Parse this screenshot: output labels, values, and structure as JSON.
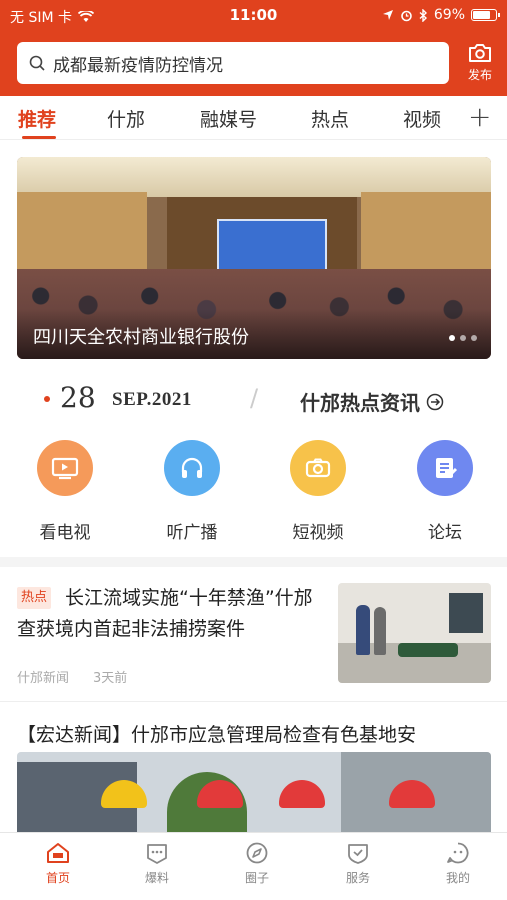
{
  "status": {
    "carrier": "无 SIM 卡",
    "time": "11:00",
    "battery": "69%",
    "battery_level": 0.69
  },
  "header": {
    "search_placeholder": "成都最新疫情防控情况",
    "publish_label": "发布"
  },
  "tabs": [
    {
      "label": "推荐",
      "active": true
    },
    {
      "label": "什邡"
    },
    {
      "label": "融媒号"
    },
    {
      "label": "热点"
    },
    {
      "label": "视频"
    }
  ],
  "banner": {
    "caption": "四川天全农村商业银行股份"
  },
  "date": {
    "day": "28",
    "month_year": "SEP.2021",
    "hot_title": "什邡热点资讯"
  },
  "quick": [
    {
      "label": "看电视",
      "color": "#f59a5a"
    },
    {
      "label": "听广播",
      "color": "#5aaef0"
    },
    {
      "label": "短视频",
      "color": "#f7c24a"
    },
    {
      "label": "论坛",
      "color": "#6f88f0"
    }
  ],
  "news1": {
    "tag": "热点",
    "title": "长江流域实施“十年禁渔”什邡查获境内首起非法捕捞案件",
    "source": "什邡新闻",
    "time": "3天前"
  },
  "news2": {
    "title": "【宏达新闻】什邡市应急管理局检查有色基地安"
  },
  "nav": [
    {
      "label": "首页",
      "active": true
    },
    {
      "label": "爆料"
    },
    {
      "label": "圈子"
    },
    {
      "label": "服务"
    },
    {
      "label": "我的"
    }
  ],
  "colors": {
    "accent": "#e0421e"
  }
}
